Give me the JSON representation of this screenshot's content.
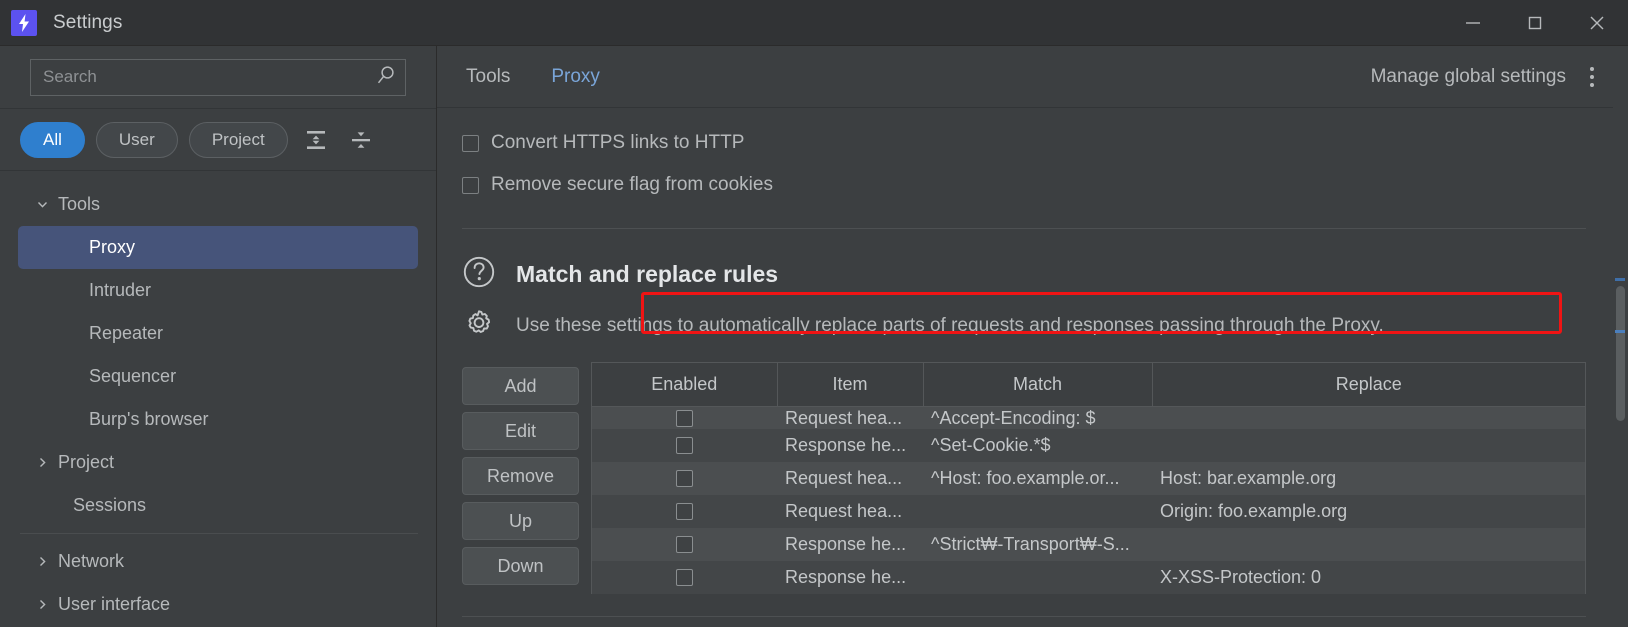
{
  "window": {
    "title": "Settings",
    "app_icon": "lightning-bolt-icon",
    "minimize_label": "Minimize",
    "maximize_label": "Maximize",
    "close_label": "Close"
  },
  "sidebar": {
    "search": {
      "placeholder": "Search",
      "value": "",
      "icon": "search-icon"
    },
    "filters": [
      {
        "label": "All",
        "active": true
      },
      {
        "label": "User",
        "active": false
      },
      {
        "label": "Project",
        "active": false
      }
    ],
    "tree_controls": [
      {
        "name": "expand-all-icon",
        "tooltip": "Expand all"
      },
      {
        "name": "collapse-all-icon",
        "tooltip": "Collapse all"
      }
    ],
    "tree": [
      {
        "label": "Tools",
        "level": 1,
        "twisty": "down",
        "selected": false
      },
      {
        "label": "Proxy",
        "level": 2,
        "twisty": "none",
        "selected": true
      },
      {
        "label": "Intruder",
        "level": 2,
        "twisty": "none",
        "selected": false
      },
      {
        "label": "Repeater",
        "level": 2,
        "twisty": "none",
        "selected": false
      },
      {
        "label": "Sequencer",
        "level": 2,
        "twisty": "none",
        "selected": false
      },
      {
        "label": "Burp's browser",
        "level": 2,
        "twisty": "none",
        "selected": false
      },
      {
        "label": "Project",
        "level": 1,
        "twisty": "right",
        "selected": false
      },
      {
        "label": "Sessions",
        "level": 1,
        "twisty": "none",
        "selected": false
      },
      {
        "label": "Network",
        "level": 1,
        "twisty": "right",
        "selected": false
      },
      {
        "label": "User interface",
        "level": 1,
        "twisty": "right",
        "selected": false
      }
    ]
  },
  "header": {
    "breadcrumb": [
      {
        "label": "Tools",
        "link": false
      },
      {
        "label": "Proxy",
        "link": true
      }
    ],
    "manage_global_settings": "Manage global settings",
    "kebab_icon": "more-options-icon"
  },
  "options": [
    {
      "label": "Convert HTTPS links to HTTP",
      "checked": false
    },
    {
      "label": "Remove secure flag from cookies",
      "checked": false
    }
  ],
  "section": {
    "help_icon": "question-mark-circle-icon",
    "title": "Match and replace rules",
    "settings_icon": "gear-icon",
    "description": "Use these settings to automatically replace parts of requests and responses passing through the Proxy."
  },
  "table_buttons": [
    {
      "label": "Add"
    },
    {
      "label": "Edit"
    },
    {
      "label": "Remove"
    },
    {
      "label": "Up"
    },
    {
      "label": "Down"
    }
  ],
  "rules_table": {
    "columns": [
      "Enabled",
      "Item",
      "Match",
      "Replace"
    ],
    "rows": [
      {
        "enabled": false,
        "item": "Request hea...",
        "match": "^Accept-Encoding: $",
        "replace": "",
        "clipped": true,
        "highlighted": false
      },
      {
        "enabled": false,
        "item": "Response he...",
        "match": "^Set-Cookie.*$",
        "replace": "",
        "clipped": false,
        "highlighted": false
      },
      {
        "enabled": false,
        "item": "Request hea...",
        "match": "^Host: foo.example.or...",
        "replace": "Host: bar.example.org",
        "clipped": false,
        "highlighted": false
      },
      {
        "enabled": false,
        "item": "Request hea...",
        "match": "",
        "replace": "Origin: foo.example.org",
        "clipped": false,
        "highlighted": false
      },
      {
        "enabled": false,
        "item": "Response he...",
        "match": "^Strict₩-Transport₩-S...",
        "replace": "",
        "clipped": false,
        "highlighted": false
      },
      {
        "enabled": false,
        "item": "Response he...",
        "match": "",
        "replace": "X-XSS-Protection: 0",
        "clipped": false,
        "highlighted": true
      }
    ]
  },
  "colors": {
    "accent_blue": "#2f7fce",
    "selection_blue": "#46547a",
    "highlight_red": "#f01414",
    "link_blue": "#7aa5d8",
    "app_icon_purple": "#5c52f0"
  }
}
